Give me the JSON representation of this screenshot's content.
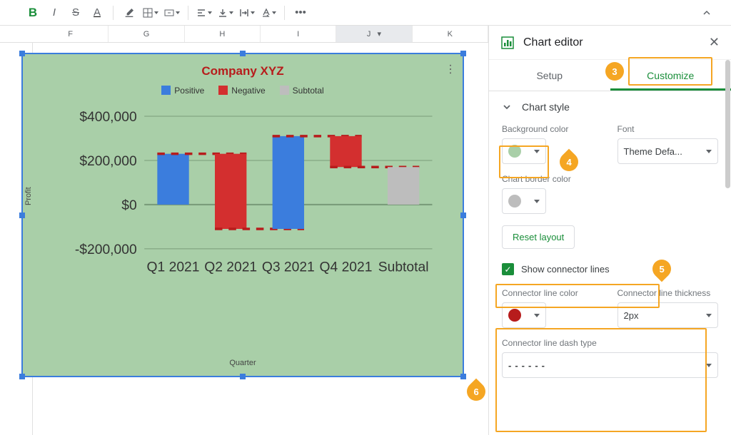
{
  "toolbar": {
    "bold": "B",
    "italic": "I",
    "strike": "S",
    "underline": "A",
    "more": "•••"
  },
  "columns": [
    "F",
    "G",
    "H",
    "I",
    "J",
    "K"
  ],
  "selected_column": "J",
  "panel": {
    "title": "Chart editor",
    "tabs": {
      "setup": "Setup",
      "customize": "Customize"
    },
    "section_chart_style": "Chart style",
    "bg_label": "Background color",
    "font_label": "Font",
    "font_value": "Theme Defa...",
    "border_label": "Chart border color",
    "reset": "Reset layout",
    "show_connectors": "Show connector lines",
    "conn_color_label": "Connector line color",
    "conn_thick_label": "Connector line thickness",
    "conn_thick_value": "2px",
    "conn_dash_label": "Connector line dash type",
    "conn_dash_sample": "------",
    "bg_color": "#a9cfa8",
    "border_color": "#bdbdbd",
    "conn_color": "#b71c1c"
  },
  "annotations": {
    "a3": "3",
    "a4": "4",
    "a5": "5",
    "a6": "6"
  },
  "chart_data": {
    "type": "bar",
    "subtype": "waterfall",
    "title": "Company XYZ",
    "xlabel": "Quarter",
    "ylabel": "Profit",
    "ylim": [
      -200000,
      400000
    ],
    "y_ticks": [
      "$400,000",
      "$200,000",
      "$0",
      "-$200,000"
    ],
    "categories": [
      "Q1 2021",
      "Q2 2021",
      "Q3 2021",
      "Q4 2021",
      "Subtotal"
    ],
    "series": [
      {
        "name": "Positive",
        "color": "#3b7ddd",
        "values": [
          230000,
          null,
          420000,
          null,
          null
        ]
      },
      {
        "name": "Negative",
        "color": "#d32f2f",
        "values": [
          null,
          -340000,
          null,
          -140000,
          null
        ]
      },
      {
        "name": "Subtotal",
        "color": "#bdbdbd",
        "values": [
          null,
          null,
          null,
          null,
          170000
        ]
      }
    ],
    "waterfall_steps": [
      {
        "label": "Q1 2021",
        "start": 0,
        "end": 230000,
        "kind": "Positive"
      },
      {
        "label": "Q2 2021",
        "start": 230000,
        "end": -110000,
        "kind": "Negative"
      },
      {
        "label": "Q3 2021",
        "start": -110000,
        "end": 310000,
        "kind": "Positive"
      },
      {
        "label": "Q4 2021",
        "start": 310000,
        "end": 170000,
        "kind": "Negative"
      },
      {
        "label": "Subtotal",
        "start": 0,
        "end": 170000,
        "kind": "Subtotal"
      }
    ],
    "connector_lines": true,
    "connector_color": "#b71c1c",
    "connector_dash": "dashed"
  }
}
